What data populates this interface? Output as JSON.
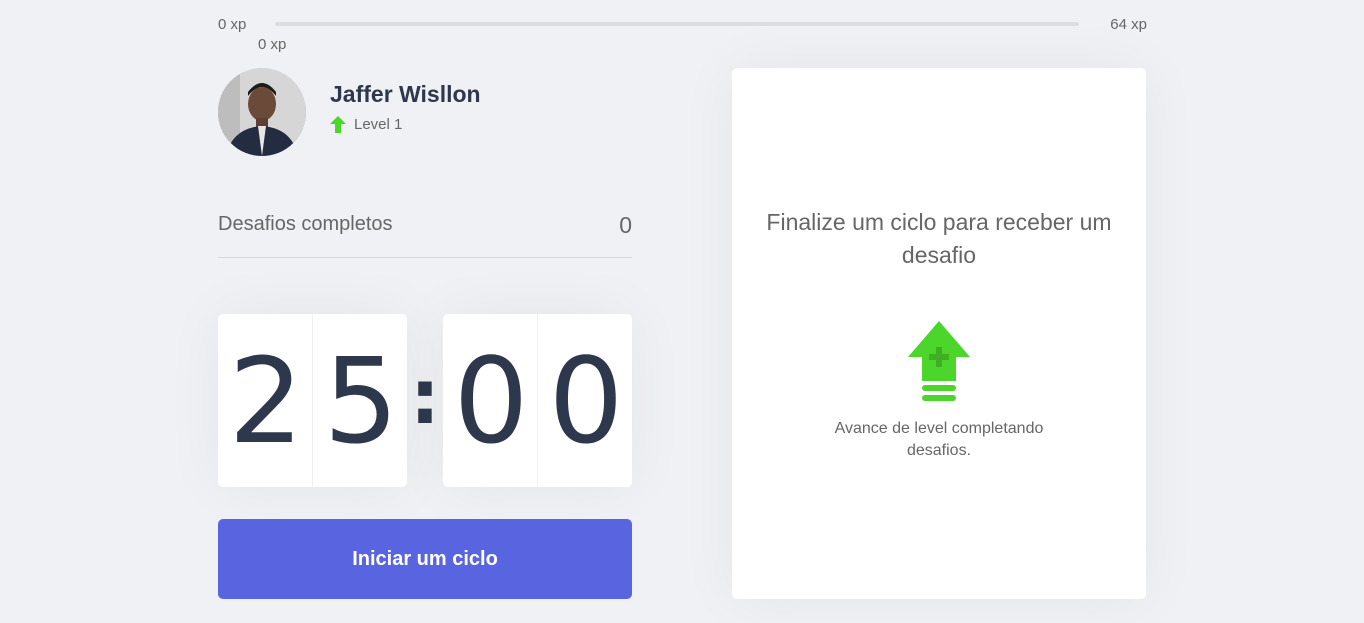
{
  "xp_bar": {
    "min_label": "0 xp",
    "max_label": "64 xp",
    "current_label": "0 xp",
    "progress": 0
  },
  "profile": {
    "name": "Jaffer Wisllon",
    "level_label": "Level 1"
  },
  "completed_challenges": {
    "label": "Desafios completos",
    "count": "0"
  },
  "countdown": {
    "minute_left": "2",
    "minute_right": "5",
    "separator": ":",
    "second_left": "0",
    "second_right": "0"
  },
  "start_button": {
    "label": "Iniciar um ciclo"
  },
  "challenge_box": {
    "title": "Finalize um ciclo para receber um desafio",
    "hint": "Avance de level completando desafios.",
    "icon": "level-up-icon"
  },
  "colors": {
    "accent": "#5965e0",
    "green": "#4cd62b",
    "title": "#2e384d",
    "text": "#666666",
    "background": "#f0f1f4"
  }
}
